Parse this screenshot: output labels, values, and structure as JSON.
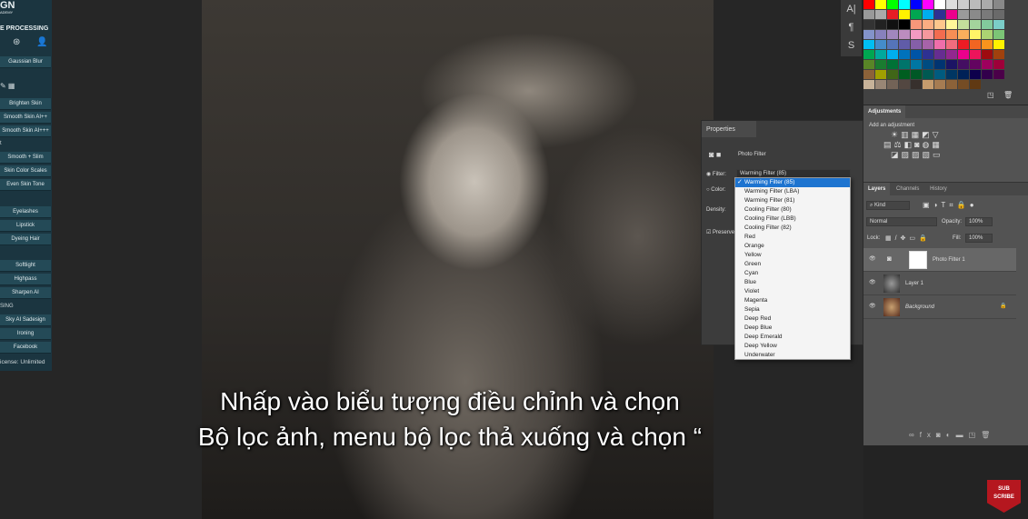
{
  "left_panel": {
    "logo": "GN",
    "logo_sub": "ADEMY",
    "section_title": "E PROCESSING",
    "buttons": [
      "Gaussian Blur",
      "Brighten Skin",
      "Smooth Skin AI++",
      "Smooth Skin AI+++",
      "Smooth + Slim",
      "Skin Color Scales",
      "Even Skin Tone",
      "Eyelashes",
      "Lipstick",
      "Dyeing Hair",
      "Softlight",
      "Highpass",
      "Sharpen AI",
      "Sky AI Sadesign",
      "Ironing",
      "Facebook"
    ],
    "section_t": "t",
    "section_sing": "SING",
    "license": "icense: Unlimited"
  },
  "swatches": [
    "#ff0000",
    "#ffff00",
    "#00ff00",
    "#00ffff",
    "#0000ff",
    "#ff00ff",
    "#ffffff",
    "#dddddd",
    "#cccccc",
    "#bbbbbb",
    "#aaaaaa",
    "#888888",
    "#999999",
    "#aaaaaa",
    "#e81d25",
    "#fff200",
    "#00a651",
    "#00aeef",
    "#2e3192",
    "#ec008c",
    "#9a9a9a",
    "#8a8a8a",
    "#7a7a7a",
    "#6a6a6a",
    "#333333",
    "#222222",
    "#111111",
    "#000000",
    "#f7977a",
    "#fbad82",
    "#fdc68c",
    "#fff799",
    "#c4df9b",
    "#a3d39c",
    "#82ca9c",
    "#7bcdc8",
    "#8393ca",
    "#8781bd",
    "#a187be",
    "#bc8cbf",
    "#f49ac1",
    "#f6989d",
    "#f26c4f",
    "#f68e55",
    "#fbaf5c",
    "#fff467",
    "#acd372",
    "#7cc576",
    "#00bff3",
    "#448ccb",
    "#5574b9",
    "#605ca8",
    "#855fa8",
    "#a763a8",
    "#f06eaa",
    "#f26d7d",
    "#ed1c24",
    "#f26522",
    "#f7941d",
    "#fff200",
    "#00a651",
    "#00a99d",
    "#00aeef",
    "#0072bc",
    "#0054a6",
    "#2e3192",
    "#662d91",
    "#92278f",
    "#ec008c",
    "#ed145b",
    "#9e0b0f",
    "#a0410d",
    "#598527",
    "#1a7b30",
    "#007236",
    "#00746b",
    "#0076a3",
    "#004b80",
    "#003471",
    "#1b1464",
    "#440e62",
    "#630460",
    "#9e005d",
    "#9e0039",
    "#8c6239",
    "#a0a000",
    "#406618",
    "#005e20",
    "#005826",
    "#005952",
    "#005b7f",
    "#003663",
    "#002157",
    "#0d004c",
    "#32004b",
    "#4b0049",
    "#c7b299",
    "#998675",
    "#736357",
    "#534741",
    "#37302d",
    "#c69c6d",
    "#a67c52",
    "#8c6239",
    "#754c24",
    "#603913"
  ],
  "tools": [
    "A|",
    "¶",
    "S"
  ],
  "properties": {
    "tab": "Properties",
    "title": "Photo Filter",
    "filter_label": "Filter:",
    "filter_value": "Warming Filter (85)",
    "color_label": "Color:",
    "density_label": "Density:",
    "preserve_label": "Preserve"
  },
  "dropdown": {
    "selected_index": 0,
    "options": [
      "Warming Filter (85)",
      "Warming Filter (LBA)",
      "Warming Filter (81)",
      "Cooling Filter (80)",
      "Cooling Filter (LBB)",
      "Cooling Filter (82)",
      "Red",
      "Orange",
      "Yellow",
      "Green",
      "Cyan",
      "Blue",
      "Violet",
      "Magenta",
      "Sepia",
      "Deep Red",
      "Deep Blue",
      "Deep Emerald",
      "Deep Yellow",
      "Underwater"
    ]
  },
  "adjustments": {
    "tab": "Adjustments",
    "subtitle": "Add an adjustment"
  },
  "layers_panel": {
    "tabs": [
      "Layers",
      "Channels",
      "History"
    ],
    "kind": "Kind",
    "blend": "Normal",
    "opacity_label": "Opacity:",
    "opacity": "100%",
    "lock_label": "Lock:",
    "fill_label": "Fill:",
    "fill": "100%",
    "layers": [
      {
        "name": "Photo Filter 1"
      },
      {
        "name": "Layer 1"
      },
      {
        "name": "Background"
      }
    ]
  },
  "captions": [
    "Nhấp vào biểu tượng điều chỉnh và chọn",
    "Bộ lọc ảnh, menu bộ lọc thả xuống và chọn “"
  ],
  "subscribe": {
    "line1": "SUB",
    "line2": "SCRIBE"
  }
}
